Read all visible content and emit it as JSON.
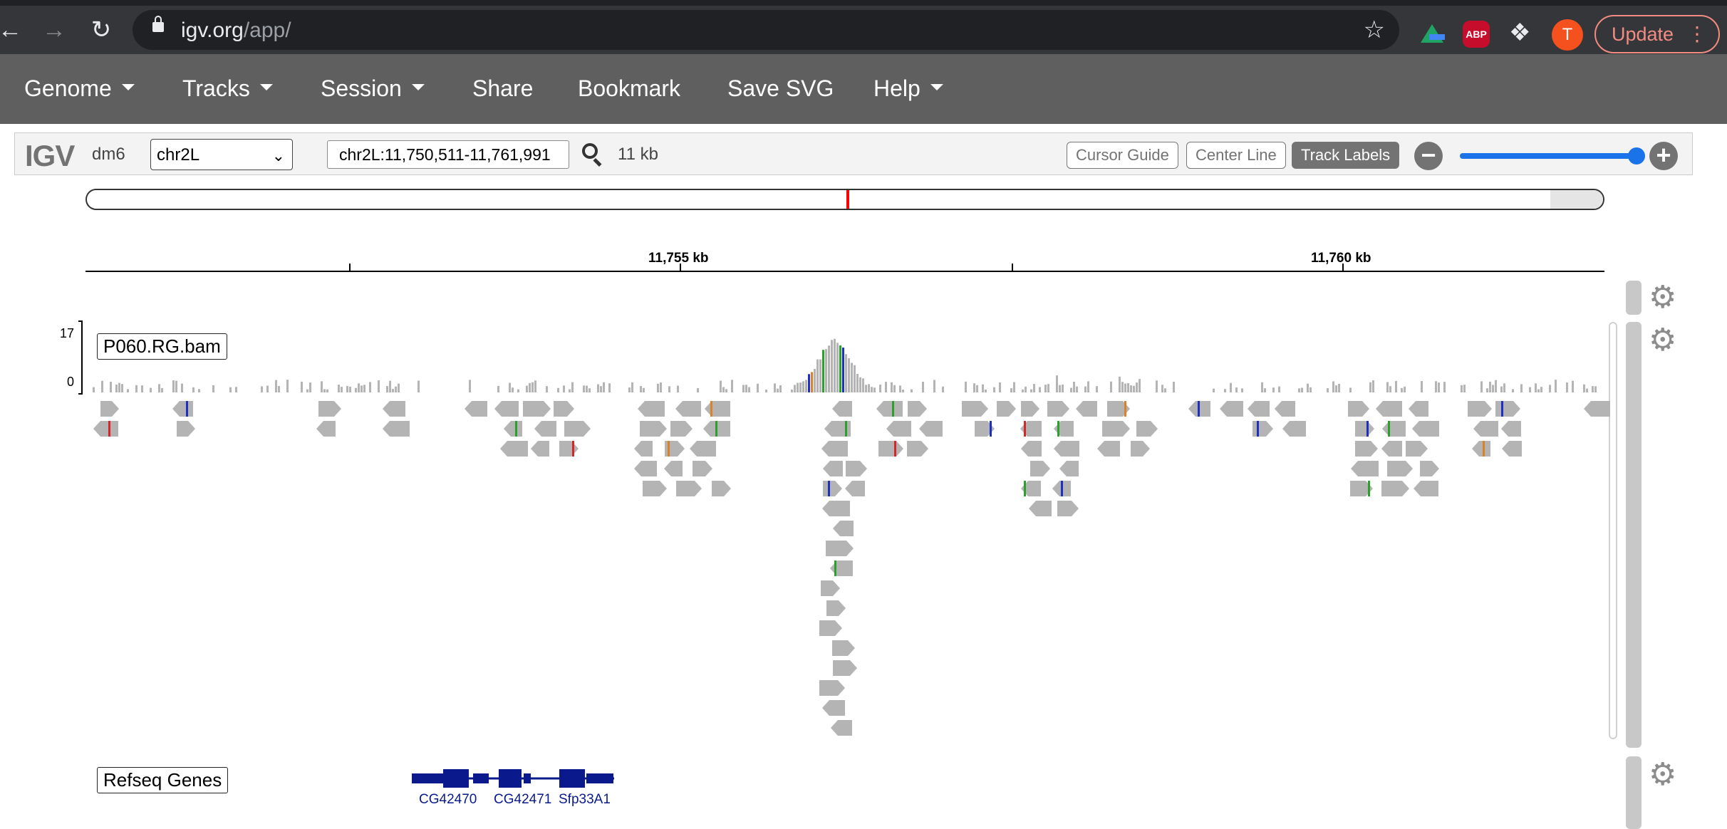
{
  "browser": {
    "url_host": "igv.org",
    "url_path": "/app/",
    "profile_initial": "T",
    "update_label": "Update",
    "extensions": [
      "google-drive-icon",
      "adblock-plus-icon",
      "puzzle-icon"
    ],
    "abp_label": "ABP"
  },
  "menubar": {
    "items": [
      {
        "label": "Genome",
        "dropdown": true
      },
      {
        "label": "Tracks",
        "dropdown": true
      },
      {
        "label": "Session",
        "dropdown": true
      },
      {
        "label": "Share",
        "dropdown": false
      },
      {
        "label": "Bookmark",
        "dropdown": false
      },
      {
        "label": "Save SVG",
        "dropdown": false
      },
      {
        "label": "Help",
        "dropdown": true
      }
    ]
  },
  "controls": {
    "logo": "IGV",
    "genome": "dm6",
    "chromosome": "chr2L",
    "locus": "chr2L:11,750,511-11,761,991",
    "window_size": "11 kb",
    "cursor_guide": "Cursor Guide",
    "center_line": "Center Line",
    "track_labels": "Track Labels",
    "zoom_level": 0.93
  },
  "ruler": {
    "labels": [
      "11,755 kb",
      "11,760 kb"
    ]
  },
  "tracks": {
    "alignment": {
      "label": "P060.RG.bam",
      "coverage_max": "17",
      "coverage_min": "0"
    },
    "genes": {
      "label": "Refseq Genes",
      "names": [
        "CG42470",
        "CG42471",
        "Sfp33A1"
      ]
    }
  },
  "colors": {
    "chrome_bg": "#35363a",
    "menubar_bg": "#5f5f5f",
    "read_gray": "#b4b4b4",
    "gene_blue": "#0a1a8c",
    "slider_blue": "#1a73e8",
    "mismatch_a": "#2ca02c",
    "mismatch_c": "#1f2fbf",
    "mismatch_g": "#d9822b",
    "mismatch_t": "#d62728"
  }
}
